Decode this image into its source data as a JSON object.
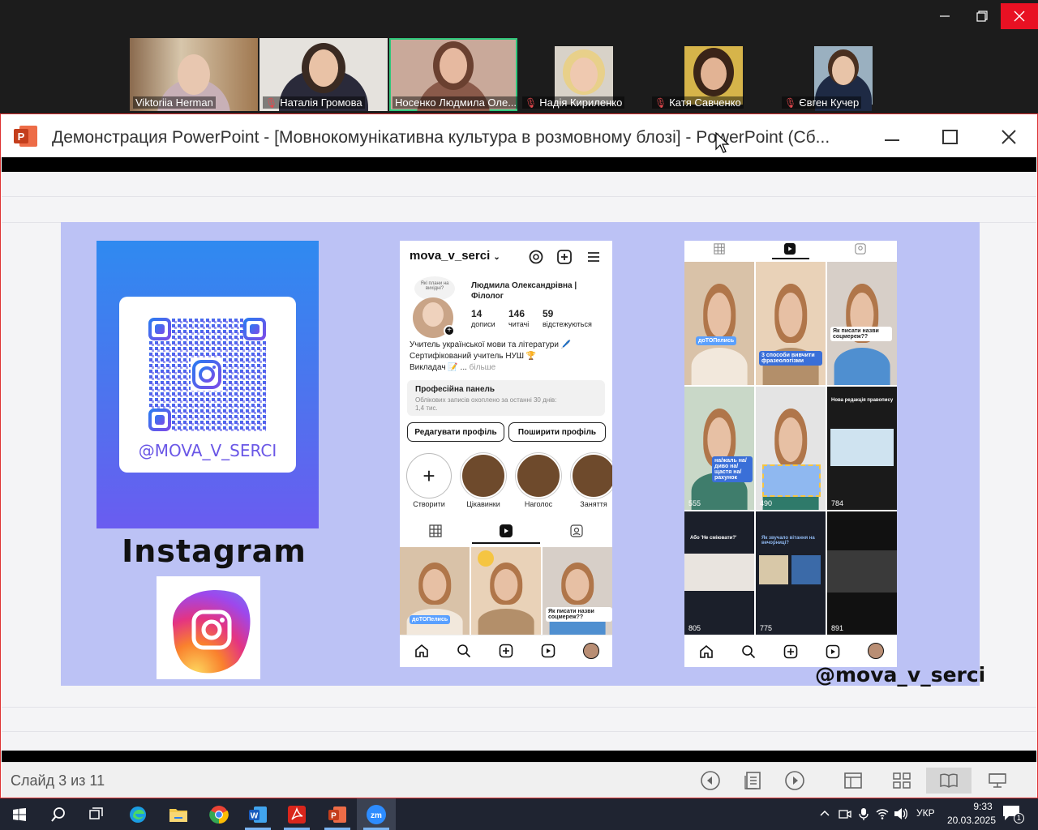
{
  "zoom": {
    "participants": [
      {
        "name": "Viktoriia Herman",
        "muted": false,
        "active": false
      },
      {
        "name": "Наталія Громова",
        "muted": true,
        "active": false
      },
      {
        "name": "Носенко Людмила Оле...",
        "muted": false,
        "active": true
      },
      {
        "name": "Надія Кириленко",
        "muted": true,
        "active": false
      },
      {
        "name": "Катя Савченко",
        "muted": true,
        "active": false
      },
      {
        "name": "Євген Кучер",
        "muted": true,
        "active": false
      }
    ]
  },
  "ppt": {
    "title": "Демонстрация PowerPoint - [Мовнокомунікативна культура в розмовному блозі] - PowerPoint (Сб...",
    "slide_counter": "Слайд 3 из 11"
  },
  "slide": {
    "qr_handle": "@MOVA_V_SERCI",
    "instagram_title": "Instagram",
    "bottom_handle": "@mova_v_serci",
    "profile": {
      "username": "mova_v_serci",
      "story_bubble": "Які плани на вихідні?",
      "full_name_1": "Людмила Олександрівна |",
      "full_name_2": "Філолог",
      "posts_count": "14",
      "posts_label": "дописи",
      "followers_count": "146",
      "followers_label": "читачі",
      "following_count": "59",
      "following_label": "відстежуються",
      "bio_1": "Учитель української мови та літератури 🖊️",
      "bio_2": "Сертифікований учитель НУШ 🏆",
      "bio_3": "Викладач 📝 ...",
      "bio_more": "більше",
      "panel_title": "Професійна панель",
      "panel_sub_1": "Облікових записів охоплено за останні 30 днів:",
      "panel_sub_2": "1,4 тис.",
      "edit_profile": "Редагувати профіль",
      "share_profile": "Поширити профіль",
      "highlights": [
        "Створити",
        "Цікавинки",
        "Наголос",
        "Заняття"
      ]
    },
    "reels_tags": {
      "a": "доТОПелись",
      "b": "3 способи вивчити фразеологізми",
      "c": "Як писати назви соцмереж??",
      "d": "на/жаль на/диво на/щастя на/рахунок",
      "e": "Нова редакція правопису",
      "f": "Як звучало вітання на вечорниці?",
      "g": "Або 'Не сміювати?'"
    },
    "reel_views": [
      "555",
      "490",
      "784",
      "805",
      "775",
      "891"
    ]
  },
  "taskbar": {
    "language": "УКР",
    "time": "9:33",
    "date": "20.03.2025",
    "notifications": "1"
  },
  "colors": {
    "panel_bg": "#bcc2f5",
    "zoom_active": "#30c77b",
    "ppt_red": "#c43e1c"
  }
}
